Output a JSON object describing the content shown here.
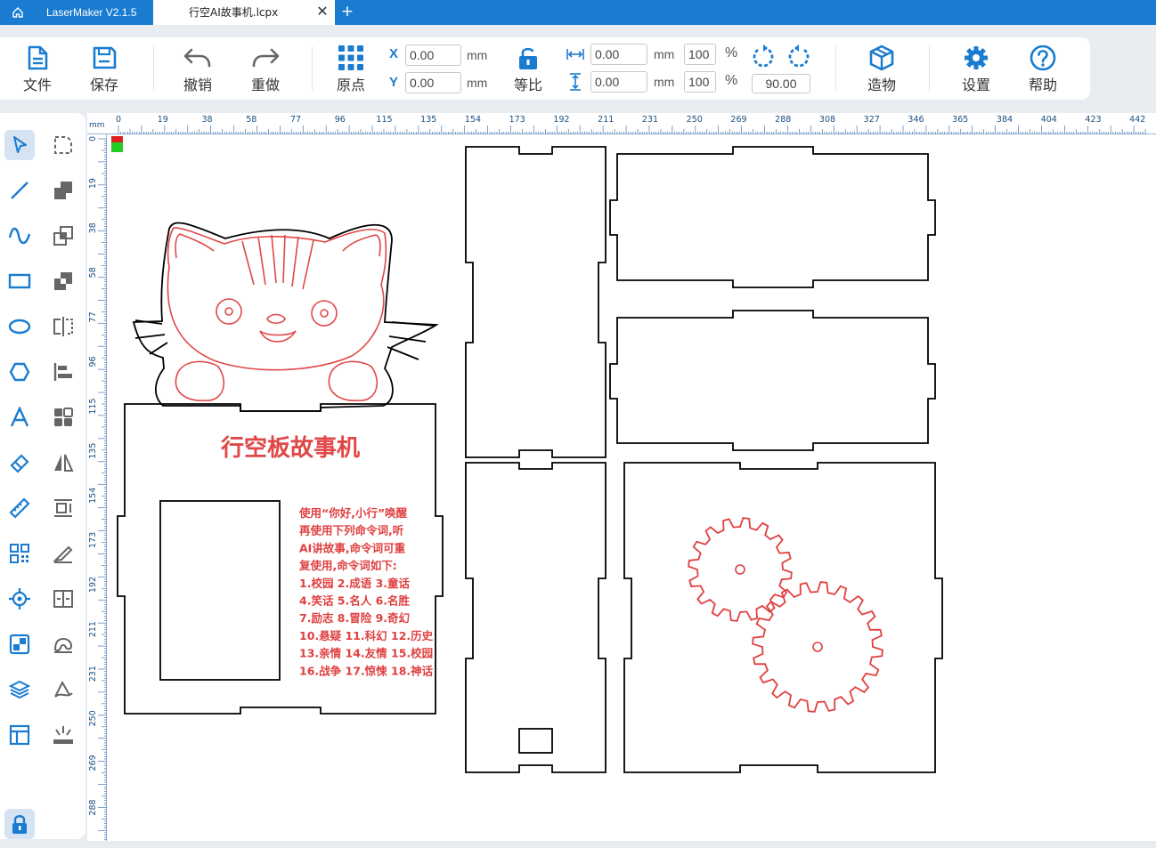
{
  "app": {
    "title": "LaserMaker V2.1.5"
  },
  "tab": {
    "label": "行空AI故事机.lcpx",
    "close": "✕",
    "new": "+"
  },
  "toolbar": {
    "file_label": "文件",
    "save_label": "保存",
    "undo_label": "撤销",
    "redo_label": "重做",
    "origin_label": "原点",
    "ratio_label": "等比",
    "build_label": "造物",
    "settings_label": "设置",
    "help_label": "帮助",
    "x_label": "X",
    "y_label": "Y",
    "x_value": "0.00",
    "y_value": "0.00",
    "width_value": "0.00",
    "height_value": "0.00",
    "width_pct": "100",
    "height_pct": "100",
    "rotation": "90.00",
    "unit_mm": "mm",
    "unit_pct": "%"
  },
  "ruler": {
    "unit": "mm",
    "top_ticks": [
      "0",
      "19",
      "38",
      "58",
      "77",
      "96",
      "115",
      "135",
      "154",
      "173",
      "192",
      "211",
      "231",
      "250",
      "269",
      "288",
      "308",
      "327",
      "346",
      "365",
      "384",
      "404",
      "423",
      "442"
    ],
    "left_ticks": [
      "0",
      "19",
      "38",
      "58",
      "77",
      "96",
      "115",
      "135",
      "154",
      "173",
      "192",
      "211",
      "231",
      "250",
      "269",
      "288"
    ]
  },
  "panel": {
    "title": "行空板故事机",
    "instructions": [
      "使用“你好,小行”唤醒",
      "再使用下列命令词,听",
      "AI讲故事,命令词可重",
      "复使用,命令词如下:",
      "1.校园 2.成语 3.童话",
      "4.笑话 5.名人 6.名胜",
      "7.励志 8.冒险 9.奇幻",
      "10.悬疑 11.科幻 12.历史",
      "13.亲情 14.友情 15.校园",
      "16.战争 17.惊悚 18.神话"
    ]
  },
  "colors": {
    "accent": "#1a7cd0",
    "cut": "#000000",
    "engrave": "#e04040"
  }
}
